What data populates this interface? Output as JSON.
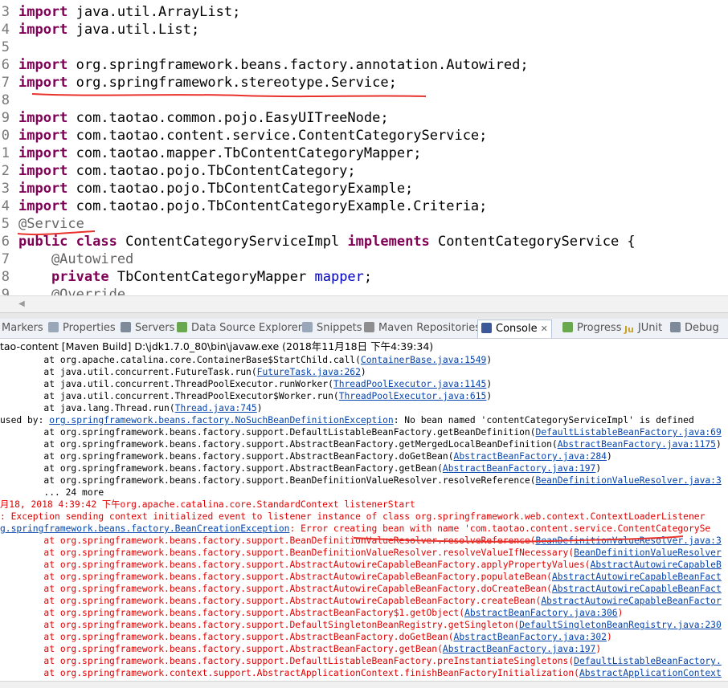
{
  "editor": {
    "lines": [
      {
        "num": "3",
        "tokens": [
          {
            "t": "import",
            "c": "kw"
          },
          {
            "t": " java.util.ArrayList;",
            "c": ""
          }
        ]
      },
      {
        "num": "4",
        "tokens": [
          {
            "t": "import",
            "c": "kw"
          },
          {
            "t": " java.util.List;",
            "c": ""
          }
        ]
      },
      {
        "num": "5",
        "tokens": []
      },
      {
        "num": "6",
        "tokens": [
          {
            "t": "import",
            "c": "kw"
          },
          {
            "t": " org.springframework.beans.factory.annotation.Autowired;",
            "c": ""
          }
        ]
      },
      {
        "num": "7",
        "tokens": [
          {
            "t": "import",
            "c": "kw"
          },
          {
            "t": " org.springframework.stereotype.Service;",
            "c": ""
          }
        ]
      },
      {
        "num": "8",
        "tokens": []
      },
      {
        "num": "9",
        "tokens": [
          {
            "t": "import",
            "c": "kw"
          },
          {
            "t": " com.taotao.common.pojo.EasyUITreeNode;",
            "c": ""
          }
        ]
      },
      {
        "num": "0",
        "tokens": [
          {
            "t": "import",
            "c": "kw"
          },
          {
            "t": " com.taotao.content.service.ContentCategoryService;",
            "c": ""
          }
        ]
      },
      {
        "num": "1",
        "tokens": [
          {
            "t": "import",
            "c": "kw"
          },
          {
            "t": " com.taotao.mapper.TbContentCategoryMapper;",
            "c": ""
          }
        ]
      },
      {
        "num": "2",
        "tokens": [
          {
            "t": "import",
            "c": "kw"
          },
          {
            "t": " com.taotao.pojo.TbContentCategory;",
            "c": ""
          }
        ]
      },
      {
        "num": "3",
        "tokens": [
          {
            "t": "import",
            "c": "kw"
          },
          {
            "t": " com.taotao.pojo.TbContentCategoryExample;",
            "c": ""
          }
        ]
      },
      {
        "num": "4",
        "tokens": [
          {
            "t": "import",
            "c": "kw"
          },
          {
            "t": " com.taotao.pojo.TbContentCategoryExample.Criteria;",
            "c": ""
          }
        ]
      },
      {
        "num": "5",
        "tokens": [
          {
            "t": "@Service",
            "c": "ann"
          }
        ]
      },
      {
        "num": "6",
        "tokens": [
          {
            "t": "public",
            "c": "kw"
          },
          {
            "t": " ",
            "c": ""
          },
          {
            "t": "class",
            "c": "kw"
          },
          {
            "t": " ContentCategoryServiceImpl ",
            "c": ""
          },
          {
            "t": "implements",
            "c": "kw"
          },
          {
            "t": " ContentCategoryService {",
            "c": ""
          }
        ]
      },
      {
        "num": "7",
        "tokens": [
          {
            "t": "    @Autowired",
            "c": "ann"
          }
        ]
      },
      {
        "num": "8",
        "tokens": [
          {
            "t": "    ",
            "c": ""
          },
          {
            "t": "private",
            "c": "kw"
          },
          {
            "t": " TbContentCategoryMapper ",
            "c": ""
          },
          {
            "t": "mapper",
            "c": "var"
          },
          {
            "t": ";",
            "c": ""
          }
        ]
      },
      {
        "num": "9",
        "tokens": [
          {
            "t": "    @Override",
            "c": "ann"
          }
        ]
      }
    ]
  },
  "tabs": [
    {
      "label": "Markers",
      "icon": "markers-icon",
      "color": "#6a8fc8"
    },
    {
      "label": "Properties",
      "icon": "properties-icon",
      "color": "#9aa7b8"
    },
    {
      "label": "Servers",
      "icon": "servers-icon",
      "color": "#7e8a99"
    },
    {
      "label": "Data Source Explorer",
      "icon": "data-source-icon",
      "color": "#6aa84f"
    },
    {
      "label": "Snippets",
      "icon": "snippets-icon",
      "color": "#9aa7b8"
    },
    {
      "label": "Maven Repositories",
      "icon": "maven-icon",
      "color": "#8e8e8e"
    },
    {
      "label": "Console",
      "icon": "console-icon",
      "color": "#3b5998",
      "active": true,
      "close": "✕"
    },
    {
      "label": "Progress",
      "icon": "progress-icon",
      "color": "#6aa84f"
    },
    {
      "label": "JUnit",
      "icon": "junit-icon",
      "color": "#c9a227",
      "prefix": "Ju"
    },
    {
      "label": "Debug",
      "icon": "debug-icon",
      "color": "#7e8a99"
    }
  ],
  "console": {
    "title": "tao-content [Maven Build] D:\\jdk1.7.0_80\\bin\\javaw.exe (2018年11月18日 下午4:39:34)",
    "lines": [
      {
        "err": false,
        "parts": [
          {
            "t": "        at org.apache.catalina.core.ContainerBase$StartChild.call("
          },
          {
            "t": "ContainerBase.java:1549",
            "link": true
          },
          {
            "t": ")"
          }
        ]
      },
      {
        "err": false,
        "parts": [
          {
            "t": "        at java.util.concurrent.FutureTask.run("
          },
          {
            "t": "FutureTask.java:262",
            "link": true
          },
          {
            "t": ")"
          }
        ]
      },
      {
        "err": false,
        "parts": [
          {
            "t": "        at java.util.concurrent.ThreadPoolExecutor.runWorker("
          },
          {
            "t": "ThreadPoolExecutor.java:1145",
            "link": true
          },
          {
            "t": ")"
          }
        ]
      },
      {
        "err": false,
        "parts": [
          {
            "t": "        at java.util.concurrent.ThreadPoolExecutor$Worker.run("
          },
          {
            "t": "ThreadPoolExecutor.java:615",
            "link": true
          },
          {
            "t": ")"
          }
        ]
      },
      {
        "err": false,
        "parts": [
          {
            "t": "        at java.lang.Thread.run("
          },
          {
            "t": "Thread.java:745",
            "link": true
          },
          {
            "t": ")"
          }
        ]
      },
      {
        "err": false,
        "parts": [
          {
            "t": "used by: "
          },
          {
            "t": "org.springframework.beans.factory.NoSuchBeanDefinitionException",
            "link": true
          },
          {
            "t": ": No bean named 'contentCategoryServiceImpl' is defined"
          }
        ]
      },
      {
        "err": false,
        "parts": [
          {
            "t": "        at org.springframework.beans.factory.support.DefaultListableBeanFactory.getBeanDefinition("
          },
          {
            "t": "DefaultListableBeanFactory.java:69",
            "link": true
          }
        ]
      },
      {
        "err": false,
        "parts": [
          {
            "t": "        at org.springframework.beans.factory.support.AbstractBeanFactory.getMergedLocalBeanDefinition("
          },
          {
            "t": "AbstractBeanFactory.java:1175",
            "link": true
          },
          {
            "t": ")"
          }
        ]
      },
      {
        "err": false,
        "parts": [
          {
            "t": "        at org.springframework.beans.factory.support.AbstractBeanFactory.doGetBean("
          },
          {
            "t": "AbstractBeanFactory.java:284",
            "link": true
          },
          {
            "t": ")"
          }
        ]
      },
      {
        "err": false,
        "parts": [
          {
            "t": "        at org.springframework.beans.factory.support.AbstractBeanFactory.getBean("
          },
          {
            "t": "AbstractBeanFactory.java:197",
            "link": true
          },
          {
            "t": ")"
          }
        ]
      },
      {
        "err": false,
        "parts": [
          {
            "t": "        at org.springframework.beans.factory.support.BeanDefinitionValueResolver.resolveReference("
          },
          {
            "t": "BeanDefinitionValueResolver.java:3",
            "link": true
          }
        ]
      },
      {
        "err": false,
        "parts": [
          {
            "t": "        ... 24 more"
          }
        ]
      },
      {
        "err": true,
        "parts": [
          {
            "t": "月18, 2018 4:39:42 下午org.apache.catalina.core.StandardContext listenerStart"
          }
        ]
      },
      {
        "err": true,
        "parts": [
          {
            "t": ": Exception sending context initialized event to listener instance of class org.springframework.web.context.ContextLoaderListener"
          }
        ]
      },
      {
        "err": true,
        "parts": [
          {
            "t": "g.springframework.beans.factory.BeanCreationException",
            "link": true
          },
          {
            "t": ": Error creating bean with name 'com.taotao.content.service.ContentCategorySe"
          }
        ]
      },
      {
        "err": true,
        "parts": [
          {
            "t": "        at org.springframework.beans.factory.support.BeanDefinitionValueResolver.resolveReference("
          },
          {
            "t": "BeanDefinitionValueResolver.java:3",
            "link": true
          }
        ]
      },
      {
        "err": true,
        "parts": [
          {
            "t": "        at org.springframework.beans.factory.support.BeanDefinitionValueResolver.resolveValueIfNecessary("
          },
          {
            "t": "BeanDefinitionValueResolver",
            "link": true
          }
        ]
      },
      {
        "err": true,
        "parts": [
          {
            "t": "        at org.springframework.beans.factory.support.AbstractAutowireCapableBeanFactory.applyPropertyValues("
          },
          {
            "t": "AbstractAutowireCapableB",
            "link": true
          }
        ]
      },
      {
        "err": true,
        "parts": [
          {
            "t": "        at org.springframework.beans.factory.support.AbstractAutowireCapableBeanFactory.populateBean("
          },
          {
            "t": "AbstractAutowireCapableBeanFact",
            "link": true
          }
        ]
      },
      {
        "err": true,
        "parts": [
          {
            "t": "        at org.springframework.beans.factory.support.AbstractAutowireCapableBeanFactory.doCreateBean("
          },
          {
            "t": "AbstractAutowireCapableBeanFact",
            "link": true
          }
        ]
      },
      {
        "err": true,
        "parts": [
          {
            "t": "        at org.springframework.beans.factory.support.AbstractAutowireCapableBeanFactory.createBean("
          },
          {
            "t": "AbstractAutowireCapableBeanFactor",
            "link": true
          }
        ]
      },
      {
        "err": true,
        "parts": [
          {
            "t": "        at org.springframework.beans.factory.support.AbstractBeanFactory$1.getObject("
          },
          {
            "t": "AbstractBeanFactory.java:306",
            "link": true
          },
          {
            "t": ")"
          }
        ]
      },
      {
        "err": true,
        "parts": [
          {
            "t": "        at org.springframework.beans.factory.support.DefaultSingletonBeanRegistry.getSingleton("
          },
          {
            "t": "DefaultSingletonBeanRegistry.java:230",
            "link": true
          }
        ]
      },
      {
        "err": true,
        "parts": [
          {
            "t": "        at org.springframework.beans.factory.support.AbstractBeanFactory.doGetBean("
          },
          {
            "t": "AbstractBeanFactory.java:302",
            "link": true
          },
          {
            "t": ")"
          }
        ]
      },
      {
        "err": true,
        "parts": [
          {
            "t": "        at org.springframework.beans.factory.support.AbstractBeanFactory.getBean("
          },
          {
            "t": "AbstractBeanFactory.java:197",
            "link": true
          },
          {
            "t": ")"
          }
        ]
      },
      {
        "err": true,
        "parts": [
          {
            "t": "        at org.springframework.beans.factory.support.DefaultListableBeanFactory.preInstantiateSingletons("
          },
          {
            "t": "DefaultListableBeanFactory.",
            "link": true
          }
        ]
      },
      {
        "err": true,
        "parts": [
          {
            "t": "        at org.springframework.context.support.AbstractApplicationContext.finishBeanFactoryInitialization("
          },
          {
            "t": "AbstractApplicationContext",
            "link": true
          }
        ]
      }
    ]
  },
  "colors": {
    "keyword": "#7f0055",
    "annotation": "#646464",
    "field": "#0000c0",
    "error": "#e00000",
    "link": "#0645ad",
    "underline_mark": "#e8322b"
  }
}
